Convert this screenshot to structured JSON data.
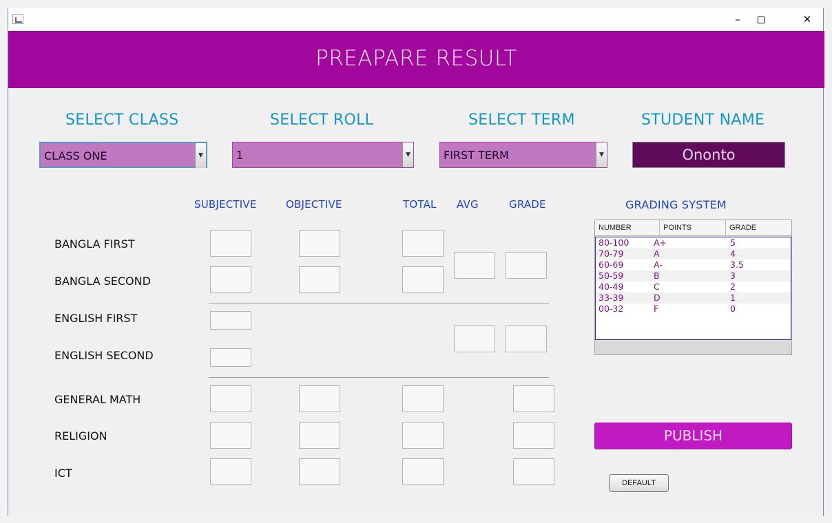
{
  "window": {
    "controls": {
      "minimize": "–",
      "close": "✕"
    }
  },
  "header": {
    "title": "PREAPARE RESULT"
  },
  "selectors": {
    "class": {
      "label": "SELECT CLASS",
      "value": "CLASS ONE"
    },
    "roll": {
      "label": "SELECT ROLL",
      "value": "1"
    },
    "term": {
      "label": "SELECT TERM",
      "value": "FIRST TERM"
    },
    "student": {
      "label": "STUDENT NAME",
      "value": "Ononto"
    }
  },
  "columns": {
    "subjective": "SUBJECTIVE",
    "objective": "OBJECTIVE",
    "total": "TOTAL",
    "avg": "AVG",
    "grade": "GRADE"
  },
  "subjects": {
    "bangla_first": "BANGLA FIRST",
    "bangla_second": "BANGLA SECOND",
    "english_first": "ENGLISH FIRST",
    "english_second": "ENGLISH SECOND",
    "general_math": "GENERAL MATH",
    "religion": "RELIGION",
    "ict": "ICT"
  },
  "grading": {
    "title": "GRADING SYSTEM",
    "headers": [
      "NUMBER",
      "POINTS",
      "GRADE"
    ],
    "rows": [
      [
        "80-100",
        "A+",
        "5"
      ],
      [
        "70-79",
        "A",
        "4"
      ],
      [
        "60-69",
        "A-",
        "3.5"
      ],
      [
        "50-59",
        "B",
        "3"
      ],
      [
        "40-49",
        "C",
        "2"
      ],
      [
        "33-39",
        "D",
        "1"
      ],
      [
        "00-32",
        "F",
        "0"
      ]
    ]
  },
  "buttons": {
    "publish": "PUBLISH",
    "default": "DEFAULT"
  },
  "colors": {
    "header": "#a1069d",
    "combo": "#c079c1",
    "student_name": "#600a5b",
    "publish": "#c21ac2",
    "label_blue": "#1596c8",
    "column_blue": "#1a44c8"
  }
}
